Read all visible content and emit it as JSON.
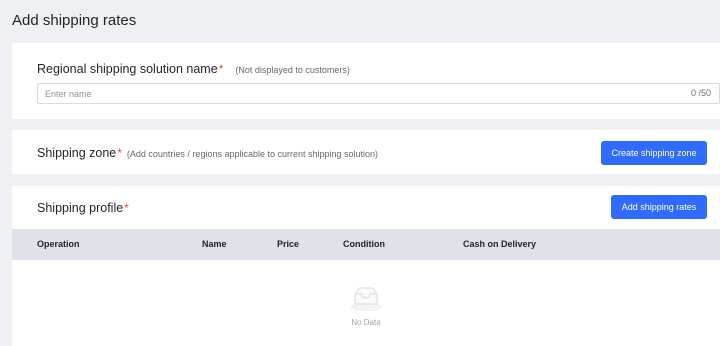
{
  "page": {
    "title": "Add shipping rates"
  },
  "solution_name": {
    "label": "Regional shipping solution name",
    "required_mark": "*",
    "hint": "(Not displayed to customers)",
    "placeholder": "Enter name",
    "value": "",
    "counter": "0 /50"
  },
  "shipping_zone": {
    "label": "Shipping zone",
    "required_mark": "*",
    "hint": "(Add countries / regions applicable to current shipping solution)",
    "button_label": "Create shipping zone"
  },
  "shipping_profile": {
    "label": "Shipping profile",
    "required_mark": "*",
    "button_label": "Add shipping rates",
    "columns": [
      "Operation",
      "Name",
      "Price",
      "Condition",
      "Cash on Delivery"
    ],
    "empty_text": "No Data",
    "empty_icon": "inbox-icon"
  },
  "colors": {
    "accent": "#2f6bff",
    "required": "#e0483e",
    "background": "#eef0f4",
    "table_header": "#dfe2e8"
  }
}
